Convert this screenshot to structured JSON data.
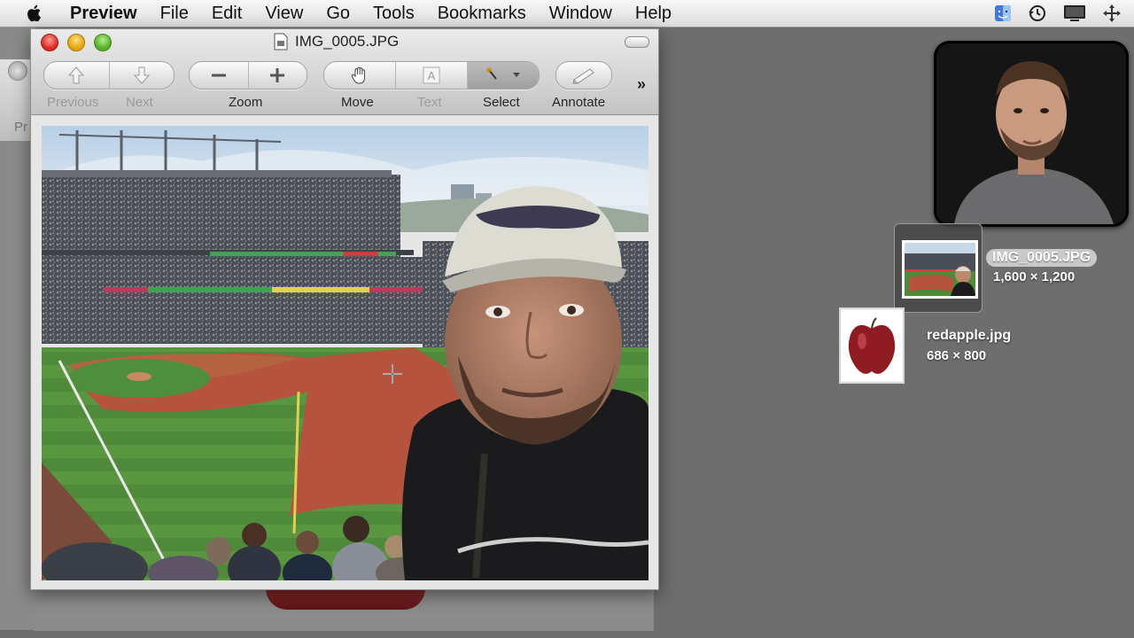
{
  "menubar": {
    "app": "Preview",
    "items": [
      "File",
      "Edit",
      "View",
      "Go",
      "Tools",
      "Bookmarks",
      "Window",
      "Help"
    ],
    "extras": [
      "finder-icon",
      "time-machine-icon",
      "display-icon",
      "move-icon"
    ]
  },
  "behind_window": {
    "label": "Pr"
  },
  "window": {
    "title": "IMG_0005.JPG",
    "toolbar": {
      "previous": "Previous",
      "next": "Next",
      "zoom": "Zoom",
      "move": "Move",
      "text": "Text",
      "select": "Select",
      "annotate": "Annotate",
      "overflow": "»"
    }
  },
  "files": [
    {
      "name": "IMG_0005.JPG",
      "dims": "1,600 × 1,200"
    },
    {
      "name": "redapple.jpg",
      "dims": "686 × 800"
    }
  ],
  "colors": {
    "desktop": "#6e6e6e",
    "close": "#d7281f",
    "minimize": "#e1a20e",
    "zoom": "#52ac24"
  }
}
